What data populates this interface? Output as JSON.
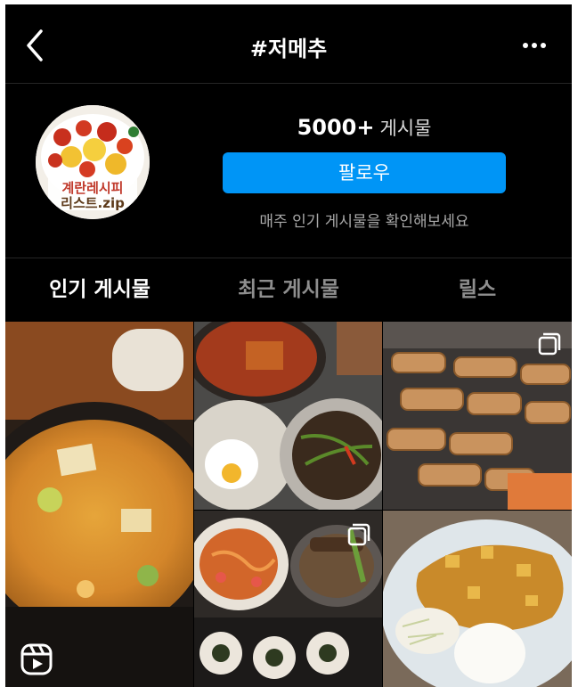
{
  "header": {
    "title": "#저메추",
    "back_icon": "chevron-left-icon",
    "more_icon": "more-horizontal-icon"
  },
  "profile": {
    "post_count": "5000+",
    "post_count_label": "게시물",
    "follow_label": "팔로우",
    "subtext": "매주 인기 게시물을 확인해보세요",
    "avatar_text": "계란레시피 리스트.zip"
  },
  "tabs": [
    {
      "label": "인기 게시물",
      "active": true
    },
    {
      "label": "최근 게시물",
      "active": false
    },
    {
      "label": "릴스",
      "active": false
    }
  ],
  "colors": {
    "background": "#000000",
    "follow_button": "#0095f6",
    "text_primary": "#ffffff",
    "text_secondary": "#a8a8a8"
  },
  "grid": {
    "tiles": [
      {
        "subject": "soybean paste stew in stone pot",
        "badge": "reels-icon"
      },
      {
        "subject": "korean home meal table",
        "badge": "none"
      },
      {
        "subject": "grilled pork belly",
        "badge": "multiple-posts-icon"
      },
      {
        "subject": "seafood pasta and lamb skewers",
        "badge": "multiple-posts-icon"
      },
      {
        "subject": "curry with pork cutlet and rice",
        "badge": "none"
      }
    ]
  }
}
